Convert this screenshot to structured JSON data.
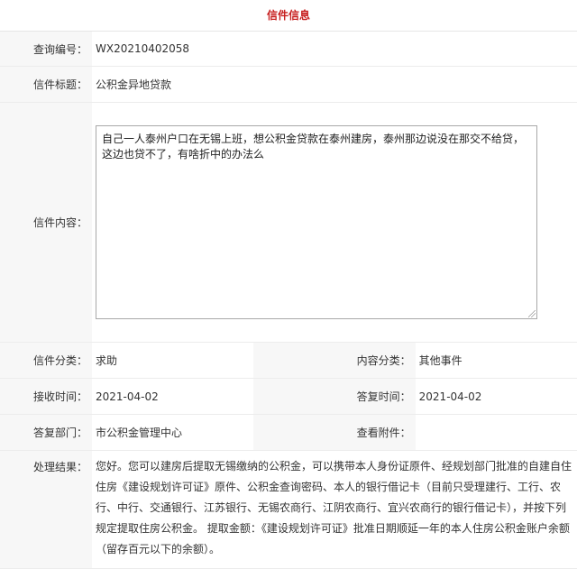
{
  "header": {
    "title": "信件信息"
  },
  "fields": {
    "query_no_label": "查询编号：",
    "query_no": "WX20210402058",
    "letter_title_label": "信件标题：",
    "letter_title": "公积金异地贷款",
    "content_label": "信件内容：",
    "content": "自己一人泰州户口在无锡上班，想公积金贷款在泰州建房，泰州那边说没在那交不给贷，这边也贷不了，有啥折中的办法么",
    "category_label": "信件分类：",
    "category": "求助",
    "content_type_label": "内容分类：",
    "content_type": "其他事件",
    "received_label": "接收时间：",
    "received": "2021-04-02",
    "replied_label": "答复时间：",
    "replied": "2021-04-02",
    "dept_label": "答复部门：",
    "dept": "市公积金管理中心",
    "attachment_label": "查看附件：",
    "attachment": "",
    "result_label": "处理结果：",
    "result": "您好。您可以建房后提取无锡缴纳的公积金，可以携带本人身份证原件、经规划部门批准的自建自住住房《建设规划许可证》原件、公积金查询密码、本人的银行借记卡（目前只受理建行、工行、农行、中行、交通银行、江苏银行、无锡农商行、江阴农商行、宜兴农商行的银行借记卡），并按下列规定提取住房公积金。 提取金额：《建设规划许可证》批准日期顺延一年的本人住房公积金账户余额（留存百元以下的余额）。"
  }
}
